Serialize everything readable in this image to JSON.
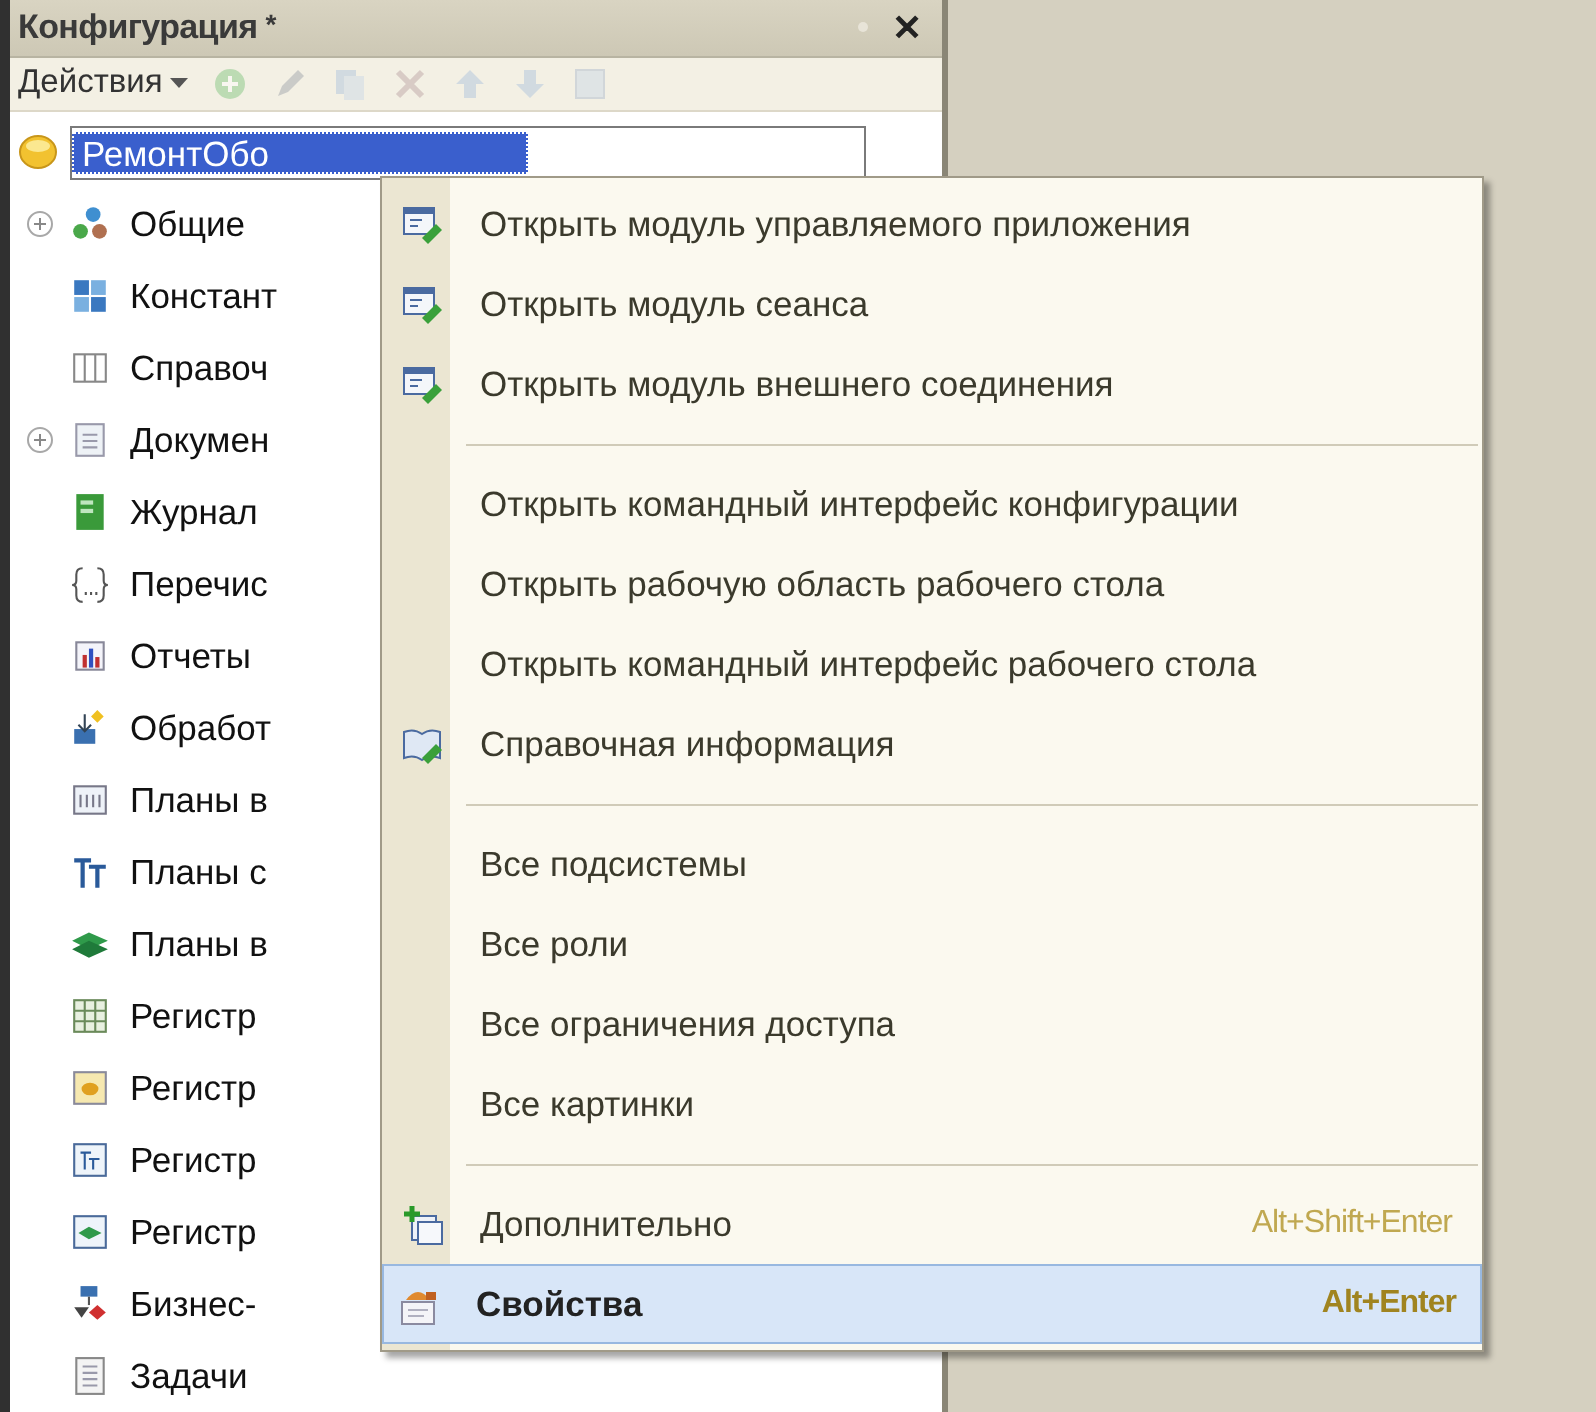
{
  "panel": {
    "title": "Конфигурация",
    "modified_mark": "*",
    "close": "✕"
  },
  "toolbar": {
    "actions_label": "Действия",
    "tools": [
      {
        "kind": "add",
        "disabled": true
      },
      {
        "kind": "edit",
        "disabled": true
      },
      {
        "kind": "copy",
        "disabled": true
      },
      {
        "kind": "delete",
        "disabled": true
      },
      {
        "kind": "up",
        "disabled": true
      },
      {
        "kind": "down",
        "disabled": true
      },
      {
        "kind": "box",
        "disabled": true
      }
    ]
  },
  "tree": {
    "root": {
      "label": "РемонтОбо",
      "selected": true,
      "editing": true
    },
    "items": [
      {
        "label": "Общие",
        "kind": "common",
        "expandable": true,
        "expanded": false
      },
      {
        "label": "Констант",
        "kind": "constants",
        "expandable": false
      },
      {
        "label": "Справоч",
        "kind": "catalogs",
        "expandable": false
      },
      {
        "label": "Докумен",
        "kind": "documents",
        "expandable": true,
        "expanded": false
      },
      {
        "label": "Журнал",
        "kind": "journals",
        "expandable": false
      },
      {
        "label": "Перечис",
        "kind": "enums",
        "expandable": false
      },
      {
        "label": "Отчеты",
        "kind": "reports",
        "expandable": false
      },
      {
        "label": "Обработ",
        "kind": "processing",
        "expandable": false
      },
      {
        "label": "Планы в",
        "kind": "chart-types",
        "expandable": false
      },
      {
        "label": "Планы с",
        "kind": "accounts",
        "expandable": false
      },
      {
        "label": "Планы в",
        "kind": "calc-types",
        "expandable": false
      },
      {
        "label": "Регистр",
        "kind": "info-reg",
        "expandable": false
      },
      {
        "label": "Регистр",
        "kind": "accum-reg",
        "expandable": false
      },
      {
        "label": "Регистр",
        "kind": "acct-reg",
        "expandable": false
      },
      {
        "label": "Регистр",
        "kind": "calc-reg",
        "expandable": false
      },
      {
        "label": "Бизнес-",
        "kind": "business",
        "expandable": false
      },
      {
        "label": "Задачи",
        "kind": "tasks",
        "expandable": false
      }
    ]
  },
  "context_menu": [
    {
      "kind": "module",
      "label": "Открыть модуль управляемого приложения",
      "selected": false,
      "default": false
    },
    {
      "kind": "module",
      "label": "Открыть модуль сеанса",
      "selected": false,
      "default": false
    },
    {
      "kind": "module",
      "label": "Открыть модуль внешнего соединения",
      "selected": false,
      "default": false
    },
    {
      "kind": "separator"
    },
    {
      "kind": "item",
      "label": "Открыть командный интерфейс конфигурации",
      "selected": false,
      "default": false
    },
    {
      "kind": "item",
      "label": "Открыть рабочую область рабочего стола",
      "selected": false,
      "default": false
    },
    {
      "kind": "item",
      "label": "Открыть командный интерфейс рабочего стола",
      "selected": false,
      "default": false
    },
    {
      "kind": "help",
      "label": "Справочная информация",
      "selected": false,
      "default": false
    },
    {
      "kind": "separator"
    },
    {
      "kind": "item",
      "label": "Все подсистемы",
      "selected": false,
      "default": false
    },
    {
      "kind": "item",
      "label": "Все роли",
      "selected": false,
      "default": false
    },
    {
      "kind": "item",
      "label": "Все ограничения доступа",
      "selected": false,
      "default": false
    },
    {
      "kind": "item",
      "label": "Все картинки",
      "selected": false,
      "default": false
    },
    {
      "kind": "separator"
    },
    {
      "kind": "more",
      "label": "Дополнительно",
      "shortcut": "Alt+Shift+Enter",
      "selected": false,
      "default": false
    },
    {
      "kind": "properties",
      "label": "Свойства",
      "shortcut": "Alt+Enter",
      "selected": true,
      "default": true
    }
  ]
}
